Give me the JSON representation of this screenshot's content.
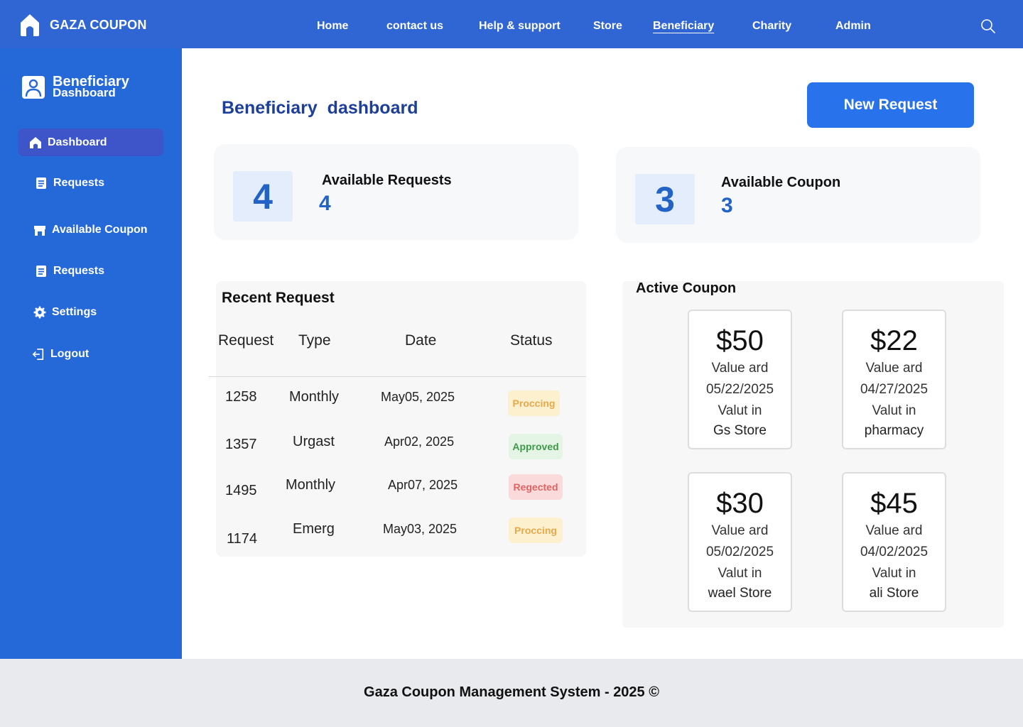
{
  "brand": {
    "name": "GAZA COUPON"
  },
  "nav": {
    "items": [
      {
        "label": "Home"
      },
      {
        "label": "contact us"
      },
      {
        "label": "Help & support"
      },
      {
        "label": "Store"
      },
      {
        "label": "Beneficiary",
        "active": true
      },
      {
        "label": "Charity"
      },
      {
        "label": "Admin"
      }
    ],
    "search_icon": "search-icon"
  },
  "sidebar": {
    "header": {
      "line1": "Beneficiary",
      "line2": "Dashboard"
    },
    "items": [
      {
        "label": "Dashboard",
        "icon": "home-icon",
        "active": true
      },
      {
        "label": "Requests",
        "icon": "document-icon"
      },
      {
        "label": "Available Coupon",
        "icon": "store-icon"
      },
      {
        "label": "Requests",
        "icon": "document-icon"
      },
      {
        "label": "Settings",
        "icon": "gear-icon"
      },
      {
        "label": "Logout",
        "icon": "logout-icon"
      }
    ]
  },
  "main": {
    "title": "Beneficiary  dashboard",
    "new_request_label": "New Request",
    "stats": [
      {
        "box": "4",
        "label": "Available Requests",
        "value": "4"
      },
      {
        "box": "3",
        "label": "Available Coupon",
        "value": "3"
      }
    ]
  },
  "recent": {
    "title": "Recent Request",
    "columns": [
      "Request",
      "Type",
      "Date",
      "Status"
    ],
    "rows": [
      {
        "id": "1258",
        "type": "Monthly",
        "date": "May05, 2025",
        "status": "Proccing"
      },
      {
        "id": "1357",
        "type": "Urgast",
        "date": "Apr02, 2025",
        "status": "Approved"
      },
      {
        "id": "1495",
        "type": "Monthly",
        "date": "Apr07, 2025",
        "status": "Regected"
      },
      {
        "id": "1174",
        "type": "Emerg",
        "date": "May03, 2025",
        "status": "Proccing"
      }
    ]
  },
  "active_coupon": {
    "title": "Active Coupon",
    "coupons": [
      {
        "amount": "$50",
        "label1": "Value ard",
        "date": "05/22/2025",
        "label2": "Valut in",
        "store": "Gs Store"
      },
      {
        "amount": "$22",
        "label1": "Value ard",
        "date": "04/27/2025",
        "label2": "Valut in",
        "store": "pharmacy"
      },
      {
        "amount": "$30",
        "label1": "Value ard",
        "date": "05/02/2025",
        "label2": "Valut in",
        "store": "wael Store"
      },
      {
        "amount": "$45",
        "label1": "Value ard",
        "date": "04/02/2025",
        "label2": "Valut in",
        "store": "ali Store"
      }
    ]
  },
  "footer": {
    "text": "Gaza Coupon Management System - 2025 ©"
  },
  "colors": {
    "topbar": "#2f66d4",
    "sidebar": "#2569d9",
    "sidebar_active": "#3d55c9",
    "accent": "#2872eb",
    "title": "#1d3f9a"
  }
}
